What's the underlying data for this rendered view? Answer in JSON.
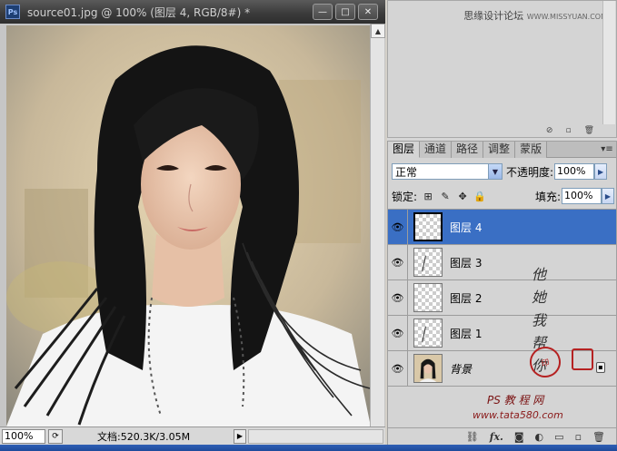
{
  "document": {
    "title": "source01.jpg @ 100% (图层 4, RGB/8#) *",
    "app_icon": "Ps",
    "window_buttons": {
      "minimize": "—",
      "maximize": "□",
      "close": "✕"
    },
    "zoom": "100%",
    "doc_size": "文档:520.3K/3.05M",
    "status_menu_arrow": "▶"
  },
  "watermark": {
    "site_name": "思缘设计论坛",
    "site_url": "WWW.MISSYUAN.COM",
    "ps_text": "PS 教 程 网",
    "url_text": "www.tata580.com",
    "calligraphy": "他 她 我 帮 你",
    "seal": "印"
  },
  "layers_panel": {
    "tabs": [
      {
        "label": "图层",
        "active": true
      },
      {
        "label": "通道",
        "active": false
      },
      {
        "label": "路径",
        "active": false
      },
      {
        "label": "调整",
        "active": false
      },
      {
        "label": "蒙版",
        "active": false
      }
    ],
    "blend_mode": "正常",
    "opacity_label": "不透明度:",
    "opacity_value": "100%",
    "lock_label": "锁定:",
    "fill_label": "填充:",
    "fill_value": "100%",
    "layers": [
      {
        "name": "图层 4",
        "selected": true,
        "visible": true,
        "type": "strands"
      },
      {
        "name": "图层 3",
        "selected": false,
        "visible": true,
        "type": "strands"
      },
      {
        "name": "图层 2",
        "selected": false,
        "visible": true,
        "type": "empty"
      },
      {
        "name": "图层 1",
        "selected": false,
        "visible": true,
        "type": "strands"
      },
      {
        "name": "背景",
        "selected": false,
        "visible": true,
        "type": "background"
      }
    ],
    "footer_icons": [
      "link-icon",
      "fx-icon",
      "mask-icon",
      "adjustment-icon",
      "folder-icon",
      "new-layer-icon",
      "trash-icon"
    ]
  },
  "colors": {
    "selected_row": "#3a6fc4",
    "titlebar": "#3a3a3a"
  }
}
